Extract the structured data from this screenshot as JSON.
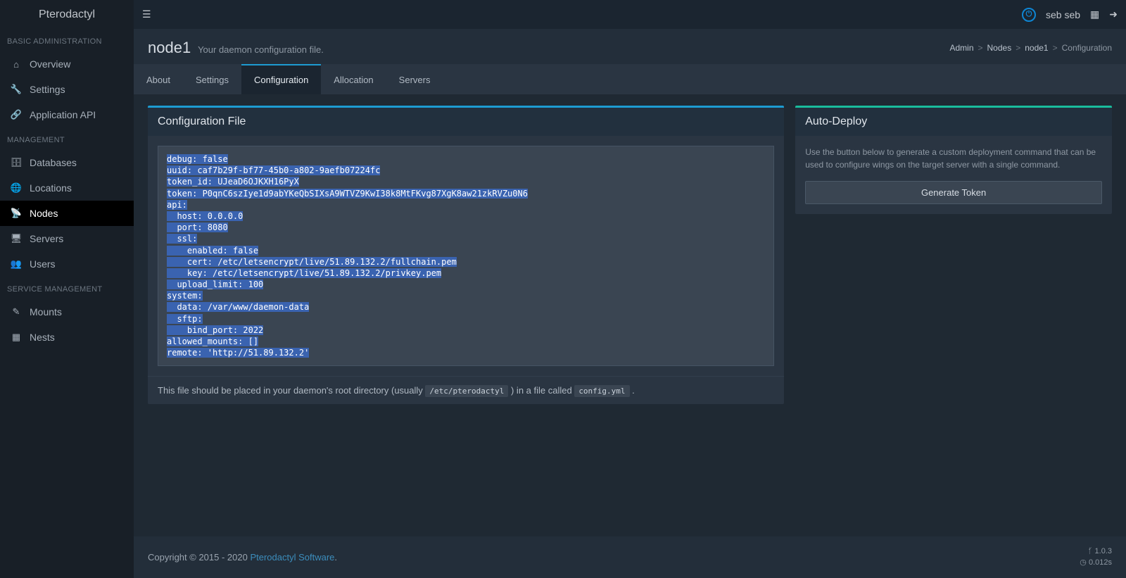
{
  "brand": "Pterodactyl",
  "user": {
    "name": "seb seb"
  },
  "sidebar": {
    "sections": [
      {
        "title": "BASIC ADMINISTRATION",
        "items": [
          {
            "icon": "⌂",
            "label": "Overview"
          },
          {
            "icon": "🔧",
            "label": "Settings"
          },
          {
            "icon": "🔗",
            "label": "Application API"
          }
        ]
      },
      {
        "title": "MANAGEMENT",
        "items": [
          {
            "icon": "🗄",
            "label": "Databases"
          },
          {
            "icon": "🌐",
            "label": "Locations"
          },
          {
            "icon": "📡",
            "label": "Nodes",
            "active": true
          },
          {
            "icon": "🖥",
            "label": "Servers"
          },
          {
            "icon": "👥",
            "label": "Users"
          }
        ]
      },
      {
        "title": "SERVICE MANAGEMENT",
        "items": [
          {
            "icon": "✎",
            "label": "Mounts"
          },
          {
            "icon": "▦",
            "label": "Nests"
          }
        ]
      }
    ]
  },
  "header": {
    "title": "node1",
    "subtitle": "Your daemon configuration file.",
    "breadcrumb": [
      "Admin",
      "Nodes",
      "node1",
      "Configuration"
    ]
  },
  "tabs": [
    "About",
    "Settings",
    "Configuration",
    "Allocation",
    "Servers"
  ],
  "active_tab": "Configuration",
  "config_box": {
    "title": "Configuration File",
    "config_text": "debug: false\nuuid: caf7b29f-bf77-45b0-a802-9aefb07224fc\ntoken_id: UJeaD6OJKXH16PyX\ntoken: P0qnC6szIye1d9abYKeQbSIXsA9WTVZ9KwI38k8MtFKvg87XgK8aw21zkRVZu0N6\napi:\n  host: 0.0.0.0\n  port: 8080\n  ssl:\n    enabled: false\n    cert: /etc/letsencrypt/live/51.89.132.2/fullchain.pem\n    key: /etc/letsencrypt/live/51.89.132.2/privkey.pem\n  upload_limit: 100\nsystem:\n  data: /var/www/daemon-data\n  sftp:\n    bind_port: 2022\nallowed_mounts: []\nremote: 'http://51.89.132.2'",
    "footer_pre": "This file should be placed in your daemon's root directory (usually ",
    "footer_code1": "/etc/pterodactyl",
    "footer_mid": " ) in a file called ",
    "footer_code2": "config.yml",
    "footer_post": " ."
  },
  "deploy_box": {
    "title": "Auto-Deploy",
    "help": "Use the button below to generate a custom deployment command that can be used to configure wings on the target server with a single command.",
    "button": "Generate Token"
  },
  "footer": {
    "copyright_pre": "Copyright © 2015 - 2020 ",
    "link": "Pterodactyl Software",
    "copyright_post": ".",
    "version": "1.0.3",
    "time": "0.012s"
  }
}
